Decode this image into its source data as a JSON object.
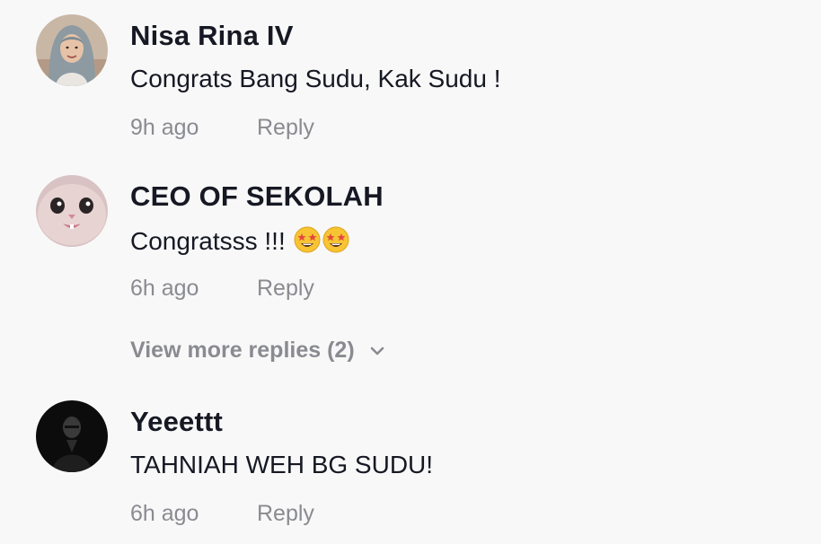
{
  "comments": [
    {
      "username": "Nisa Rina IV",
      "text": "Congrats Bang Sudu, Kak Sudu !",
      "time": "9h ago",
      "reply_label": "Reply",
      "avatar": "avatar-woman-hijab"
    },
    {
      "username": "CEO OF SEKOLAH",
      "text": "Congratsss !!! ",
      "emojis": [
        "star-struck-emoji",
        "star-struck-emoji"
      ],
      "time": "6h ago",
      "reply_label": "Reply",
      "avatar": "avatar-cat"
    },
    {
      "username": "Yeeettt",
      "text": "TAHNIAH WEH BG SUDU!",
      "time": "6h ago",
      "reply_label": "Reply",
      "avatar": "avatar-dark-person"
    }
  ],
  "view_more_replies": "View more replies (2)",
  "colors": {
    "background": "#f8f8f8",
    "username": "#161823",
    "meta": "#8a8b91"
  }
}
